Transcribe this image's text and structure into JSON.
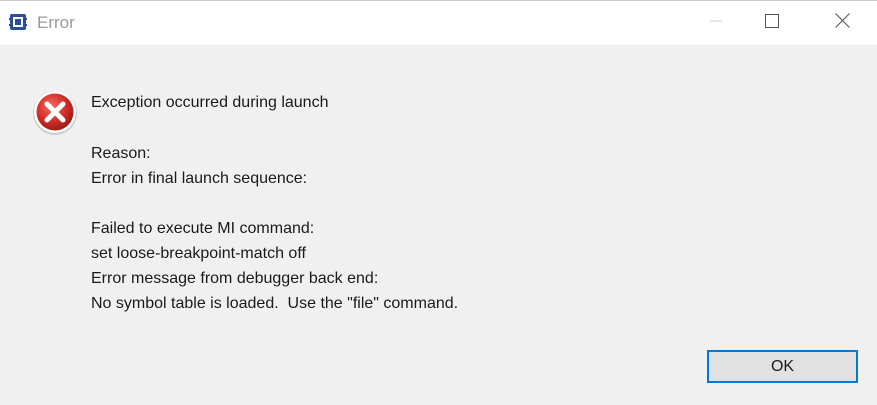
{
  "window": {
    "title": "Error",
    "app_icon": "app-chip-icon",
    "controls": [
      "minimize-icon",
      "maximize-icon",
      "close-icon"
    ]
  },
  "dialog": {
    "icon": "error-icon",
    "headline": "Exception occurred during launch",
    "lines": [
      "Reason:",
      "Error in final launch sequence:",
      "Failed to execute MI command:",
      "set loose-breakpoint-match off",
      "Error message from debugger back end:",
      "No symbol table is loaded.  Use the \"file\" command."
    ]
  },
  "buttons": {
    "ok_label": "OK"
  },
  "colors": {
    "accent": "#0078d7",
    "error_red": "#d9352f",
    "background": "#f0f0f0"
  }
}
